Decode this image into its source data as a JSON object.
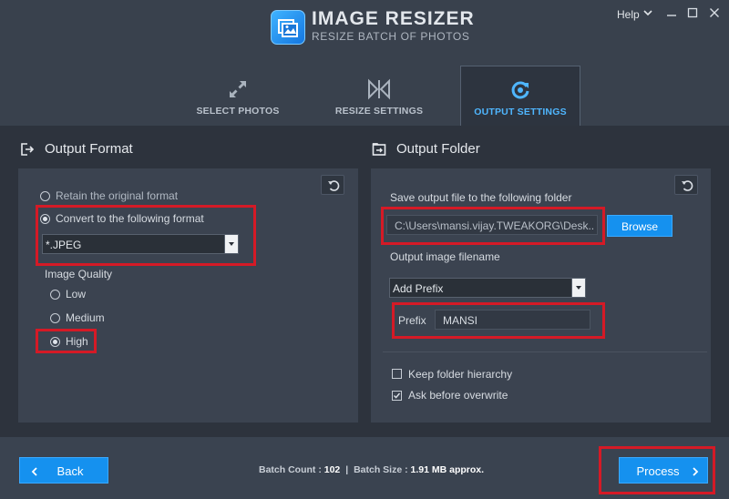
{
  "app": {
    "title": "IMAGE RESIZER",
    "subtitle": "RESIZE BATCH OF PHOTOS",
    "help_label": "Help"
  },
  "tabs": [
    {
      "label": "SELECT PHOTOS",
      "icon": "expand-arrows-icon",
      "active": false
    },
    {
      "label": "RESIZE SETTINGS",
      "icon": "resize-settings-icon",
      "active": false
    },
    {
      "label": "OUTPUT SETTINGS",
      "icon": "output-settings-icon",
      "active": true
    }
  ],
  "output_format": {
    "title": "Output Format",
    "retain_label": "Retain the original format",
    "convert_label": "Convert to the following format",
    "selected_option": "convert",
    "format_value": "*.JPEG",
    "quality_label": "Image Quality",
    "quality_options": [
      "Low",
      "Medium",
      "High"
    ],
    "quality_selected": "High"
  },
  "output_folder": {
    "title": "Output Folder",
    "save_label": "Save output file to the following folder",
    "folder_path": "C:\\Users\\mansi.vijay.TWEAKORG\\Desk...",
    "browse_label": "Browse",
    "filename_label": "Output image filename",
    "filename_mode": "Add Prefix",
    "prefix_label": "Prefix",
    "prefix_value": "MANSI",
    "keep_hierarchy_label": "Keep folder hierarchy",
    "keep_hierarchy_checked": false,
    "ask_overwrite_label": "Ask before overwrite",
    "ask_overwrite_checked": true
  },
  "footer": {
    "back_label": "Back",
    "process_label": "Process",
    "batch_count_label": "Batch Count :",
    "batch_count_value": "102",
    "separator": "|",
    "batch_size_label": "Batch Size :",
    "batch_size_value": "1.91 MB approx."
  },
  "colors": {
    "accent": "#1591ef",
    "active_tab_text": "#4fb6ff",
    "highlight_box": "#d51a26",
    "panel_bg": "#3b4350",
    "window_bg": "#2d333d"
  }
}
